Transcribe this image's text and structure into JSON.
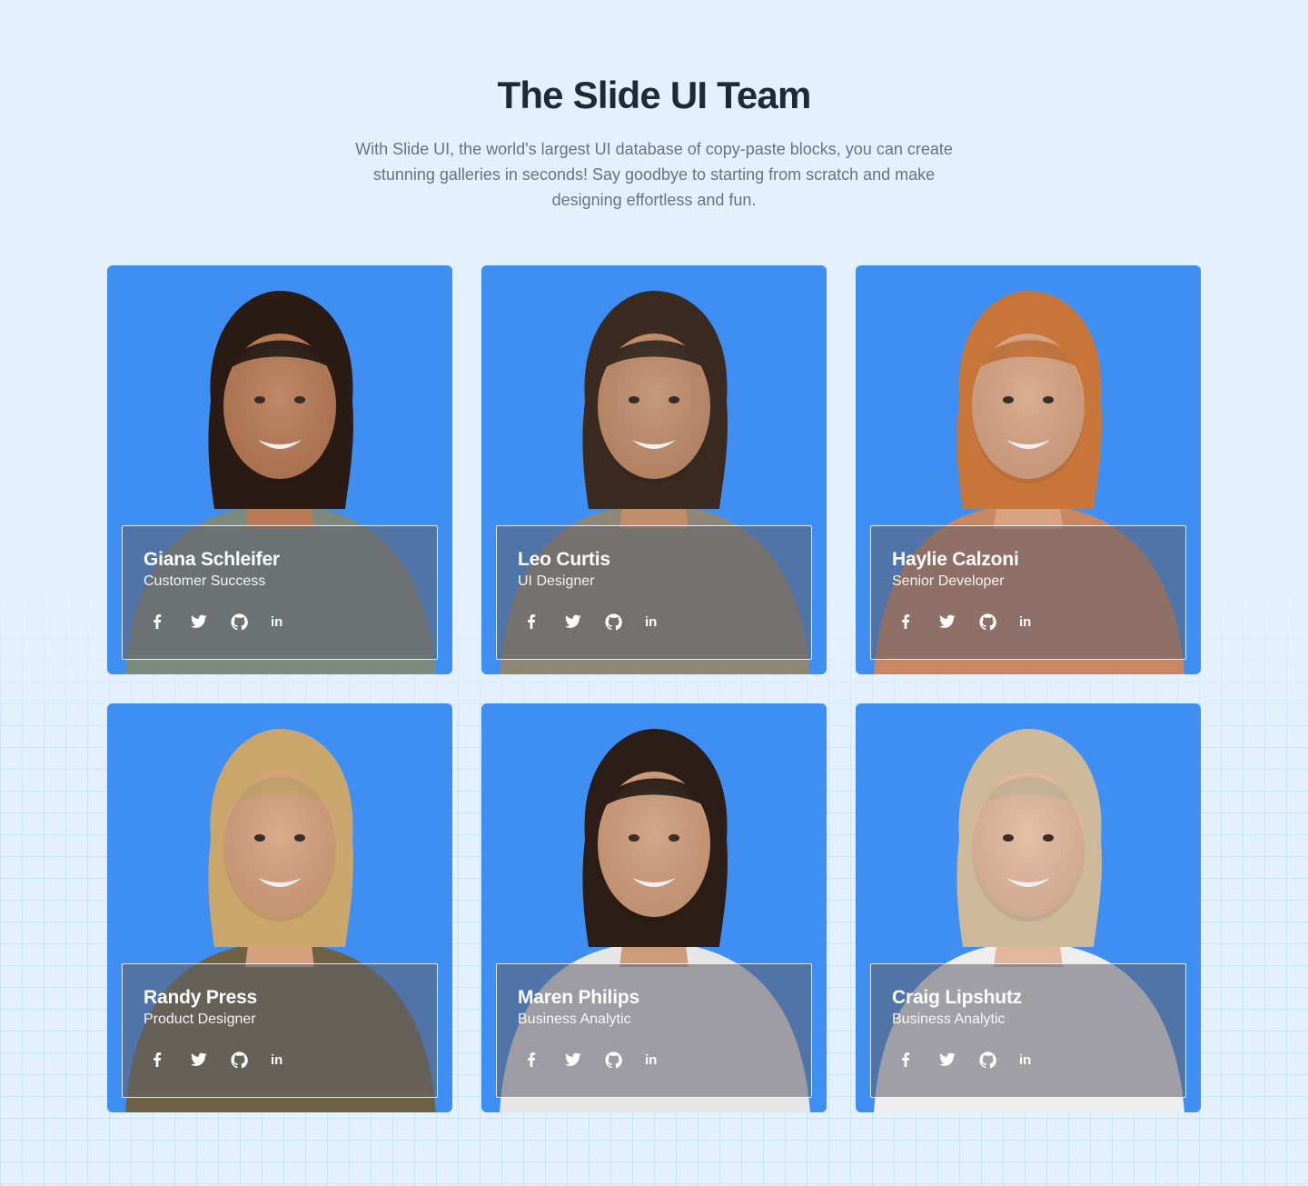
{
  "hero": {
    "title": "The Slide UI Team",
    "description": "With Slide UI, the world's largest UI database of copy-paste blocks, you can create stunning galleries in seconds! Say goodbye to starting from scratch and make designing effortless and fun."
  },
  "colors": {
    "page_background": "#e3f0fd",
    "card_background": "#3f8ff2",
    "title": "#1f2937",
    "body_text": "#6b7280"
  },
  "social_icons": [
    "facebook-icon",
    "twitter-icon",
    "github-icon",
    "linkedin-icon"
  ],
  "linkedin_glyph": "in",
  "team": [
    {
      "name": "Giana Schleifer",
      "role": "Customer Success",
      "skin": "#b77a55",
      "hair": "#2a1b14",
      "shirt": "#7c8a7e"
    },
    {
      "name": "Leo Curtis",
      "role": "UI Designer",
      "skin": "#c08c6a",
      "hair": "#3a2a20",
      "shirt": "#8f8776"
    },
    {
      "name": "Haylie Calzoni",
      "role": "Senior Developer",
      "skin": "#d7a383",
      "hair": "#c8753a",
      "shirt": "#c98663"
    },
    {
      "name": "Randy Press",
      "role": "Product Designer",
      "skin": "#d6a07c",
      "hair": "#c9a66b",
      "shirt": "#6d6243"
    },
    {
      "name": "Maren Philips",
      "role": "Business Analytic",
      "skin": "#cf9c7a",
      "hair": "#2c1e16",
      "shirt": "#e6e6e6"
    },
    {
      "name": "Craig Lipshutz",
      "role": "Business Analytic",
      "skin": "#e2b79d",
      "hair": "#cdb89a",
      "shirt": "#eeeeee"
    }
  ]
}
